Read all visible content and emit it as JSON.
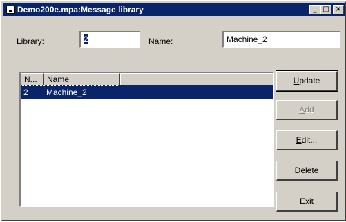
{
  "window": {
    "title": "Demo200e.mpa:Message library",
    "controls": {
      "minimize": "_",
      "maximize": "□",
      "close": "×"
    }
  },
  "form": {
    "library_label": "Library:",
    "library_value": "2",
    "name_label": "Name:",
    "name_value": "Machine_2"
  },
  "list": {
    "columns": [
      "N...",
      "Name",
      ""
    ],
    "rows": [
      {
        "number": "2",
        "name": "Machine_2"
      }
    ]
  },
  "buttons": {
    "update": {
      "mnemonic": "U",
      "rest": "pdate"
    },
    "add": {
      "mnemonic": "A",
      "rest": "dd"
    },
    "edit": {
      "mnemonic": "E",
      "rest": "dit..."
    },
    "delete": {
      "mnemonic": "D",
      "rest": "elete"
    },
    "exit": {
      "pre": "E",
      "mnemonic": "x",
      "rest": "it"
    }
  },
  "colors": {
    "selection": "#0a246a",
    "face": "#d4d0c8"
  }
}
